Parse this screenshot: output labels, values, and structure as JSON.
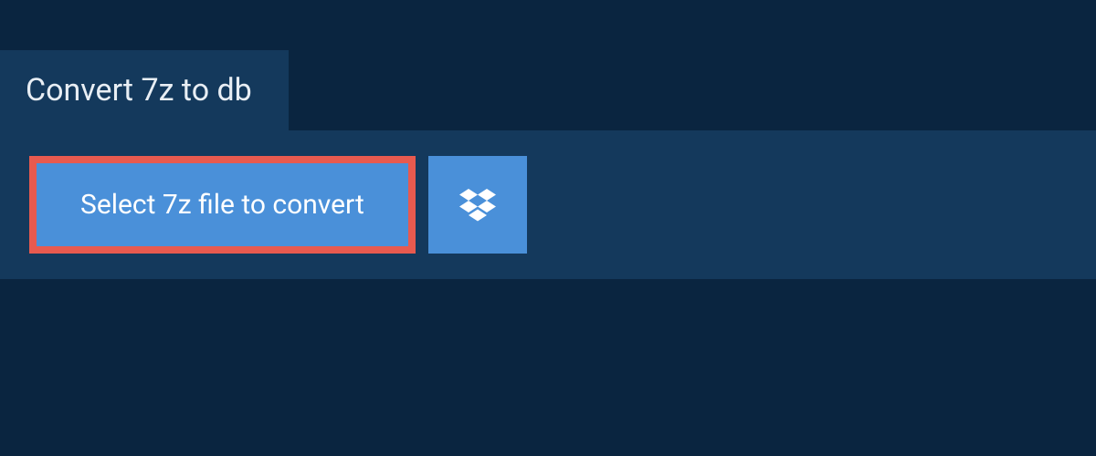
{
  "header": {
    "title": "Convert 7z to db"
  },
  "actions": {
    "select_file_label": "Select 7z file to convert",
    "dropbox_icon_name": "dropbox"
  },
  "colors": {
    "page_bg": "#0a2540",
    "panel_bg": "#14395c",
    "button_bg": "#4a90d9",
    "highlight_border": "#e85a4f",
    "text_light": "#e8eef4",
    "text_white": "#ffffff"
  }
}
